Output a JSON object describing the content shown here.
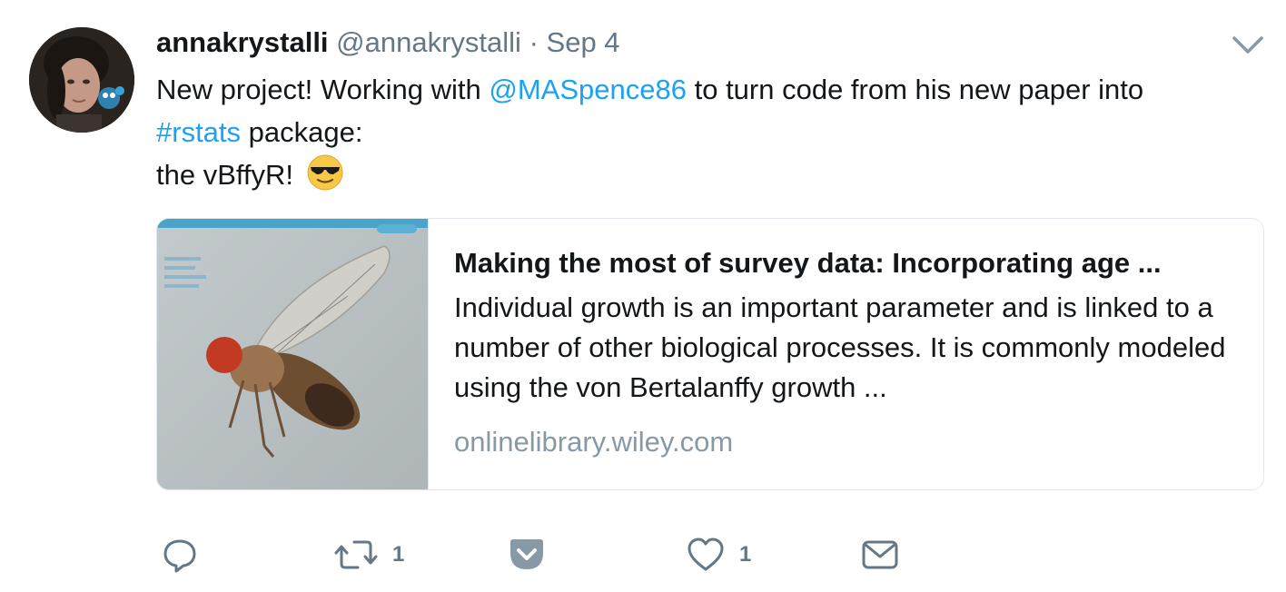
{
  "tweet": {
    "author_name": "annakrystalli",
    "handle": "@annakrystalli",
    "separator": "·",
    "timestamp": "Sep 4",
    "text_part1": "New project! Working with ",
    "mention": "@MASpence86",
    "text_part2": " to turn code from his new paper into",
    "hashtag": "#rstats",
    "text_part3": " package:",
    "text_line3": "the vBffyR!",
    "emoji": "smiling-face-with-sunglasses"
  },
  "card": {
    "title": "Making the most of survey data: Incorporating age ...",
    "description": "Individual growth is an important parameter and is linked to a number of other biological processes. It is commonly modeled using the von Bertalanffy growth ...",
    "domain": "onlinelibrary.wiley.com",
    "image": "fruit-fly-journal-cover"
  },
  "actions": {
    "reply_icon": "reply-icon",
    "retweet_count": "1",
    "pocket_icon": "pocket-icon",
    "like_count": "1",
    "dm_icon": "envelope-icon"
  },
  "colors": {
    "link": "#1da1f2",
    "secondary_text": "#657786",
    "border": "#e1e8ed"
  }
}
